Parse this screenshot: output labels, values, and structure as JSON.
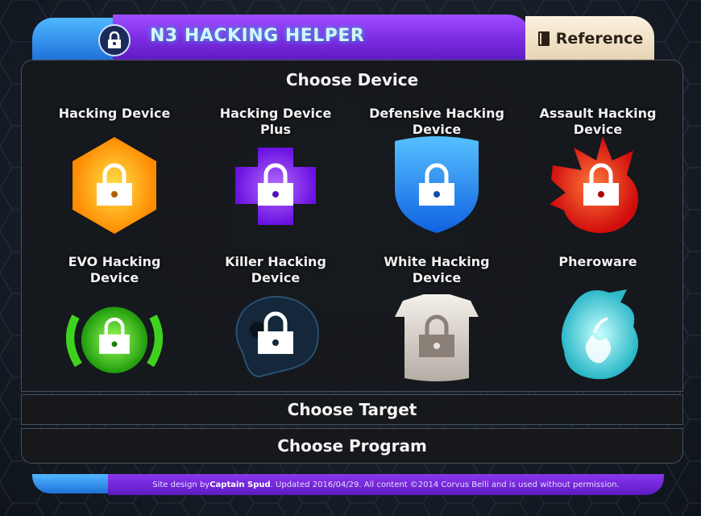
{
  "header": {
    "title": "N3 HACKING HELPER",
    "title_icon": "lock-icon",
    "reference_label": "Reference",
    "reference_icon": "book-icon"
  },
  "main": {
    "section_title": "Choose Device",
    "devices": [
      {
        "label": "Hacking Device",
        "color": "#ffb000"
      },
      {
        "label": "Hacking Device Plus",
        "color": "#8b2cff"
      },
      {
        "label": "Defensive Hacking Device",
        "color": "#1f8cff"
      },
      {
        "label": "Assault Hacking Device",
        "color": "#ff3a20"
      },
      {
        "label": "EVO Hacking Device",
        "color": "#3ed21f"
      },
      {
        "label": "Killer Hacking Device",
        "color": "#14273b"
      },
      {
        "label": "White Hacking Device",
        "color": "#d8d2cc"
      },
      {
        "label": "Pheroware",
        "color": "#5fe0e8"
      }
    ]
  },
  "sections": {
    "target_label": "Choose Target",
    "program_label": "Choose Program"
  },
  "footer": {
    "prefix": "Site design by ",
    "author": "Captain Spud",
    "suffix": ". Updated 2016/04/29. All content ©2014 Corvus Belli and is used without permission."
  }
}
